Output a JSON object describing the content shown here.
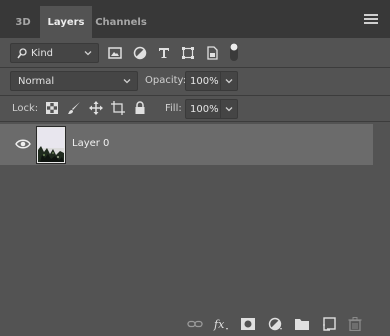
{
  "tabs": [
    {
      "label": "3D"
    },
    {
      "label": "Layers"
    },
    {
      "label": "Channels"
    }
  ],
  "filter": {
    "kind_label": "Kind",
    "icons": [
      "pixel-filter-icon",
      "adjustment-filter-icon",
      "type-filter-icon",
      "shape-filter-icon",
      "smart-object-filter-icon",
      "filter-toggle"
    ]
  },
  "blend": {
    "mode": "Normal",
    "opacity_label": "Opacity:",
    "opacity_value": "100%",
    "fill_label": "Fill:",
    "fill_value": "100%"
  },
  "lock": {
    "label": "Lock:",
    "icons": [
      "lock-transparent-icon",
      "lock-image-icon",
      "lock-position-icon",
      "lock-artboard-icon",
      "lock-all-icon"
    ]
  },
  "layers": [
    {
      "name": "Layer 0",
      "visible": true,
      "selected": true
    }
  ],
  "footer_icons": [
    "link-layers-icon",
    "layer-style-icon",
    "add-mask-icon",
    "adjustment-layer-icon",
    "new-group-icon",
    "new-layer-icon",
    "delete-layer-icon"
  ],
  "colors": {
    "panel": "#535353",
    "tabbar": "#383838",
    "selected_row": "#6b6b6b"
  }
}
